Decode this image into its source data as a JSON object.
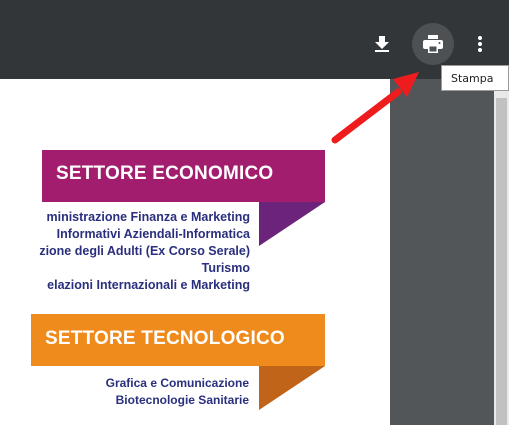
{
  "toolbar": {
    "download_icon": "download-icon",
    "print_icon": "print-icon",
    "more_icon": "more-vert-icon"
  },
  "tooltip": {
    "text": "Stampa"
  },
  "document": {
    "section1": {
      "title": "SETTORE ECONOMICO",
      "color": "#a31d6e",
      "lines": [
        "ministrazione Finanza e Marketing",
        "Informativi Aziendali-Informatica",
        "zione degli Adulti (Ex Corso Serale)",
        "Turismo",
        "elazioni Internazionali e Marketing"
      ]
    },
    "section2": {
      "title": "SETTORE TECNOLOGICO",
      "color": "#ef8b1c",
      "lines": [
        "Grafica e Comunicazione",
        "Biotecnologie Sanitarie"
      ]
    }
  },
  "annotation": {
    "arrow_color": "#ee1c1c"
  }
}
